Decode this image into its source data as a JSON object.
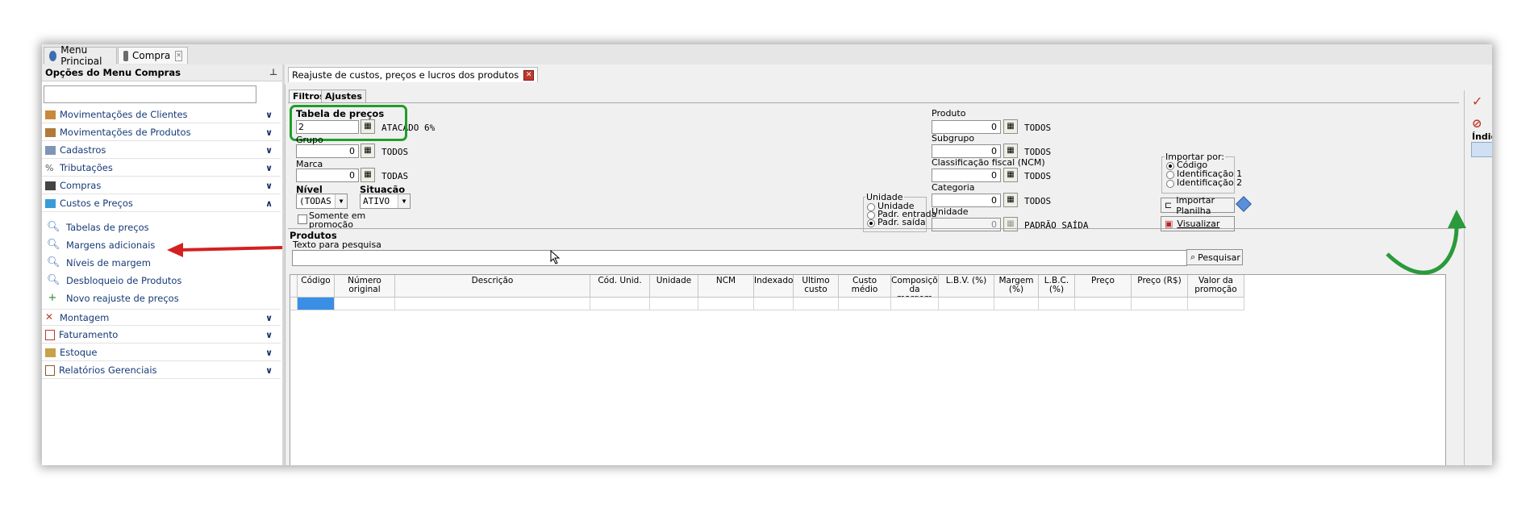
{
  "top_tabs": [
    {
      "label": "Menu Principal"
    },
    {
      "label": "Compra"
    }
  ],
  "sidebar": {
    "title": "Opções do Menu Compras",
    "categories": [
      {
        "label": "Movimentações de Clientes"
      },
      {
        "label": "Movimentações de Produtos"
      },
      {
        "label": "Cadastros"
      },
      {
        "label": "Tributações"
      },
      {
        "label": "Compras"
      },
      {
        "label": "Custos e Preços"
      },
      {
        "label": "Montagem"
      },
      {
        "label": "Faturamento"
      },
      {
        "label": "Estoque"
      },
      {
        "label": "Relatórios Gerenciais"
      }
    ],
    "sub_items": [
      {
        "label": "Tabelas de preços"
      },
      {
        "label": "Margens adicionais"
      },
      {
        "label": "Níveis de margem"
      },
      {
        "label": "Desbloqueio de Produtos"
      },
      {
        "label": "Novo reajuste de preços"
      }
    ]
  },
  "document_tab": {
    "label": "Reajuste de custos, preços e lucros dos produtos"
  },
  "subtabs": [
    {
      "label": "Filtros"
    },
    {
      "label": "Ajustes"
    }
  ],
  "filters": {
    "tabela_label": "Tabela de preços",
    "tabela_value": "2",
    "tabela_desc": "ATACADO 6%",
    "grupo_label": "Grupo",
    "grupo_value": "0",
    "grupo_desc": "TODOS",
    "marca_label": "Marca",
    "marca_value": "0",
    "marca_desc": "TODAS",
    "nivel_label": "Nível",
    "nivel_value": "(TODAS",
    "situacao_label": "Situação",
    "situacao_value": "ATIVO",
    "promo_label_1": "Somente em",
    "promo_label_2": "promoção",
    "unidade_group": "Unidade",
    "unidade_opts": [
      "Unidade",
      "Padr. entrada",
      "Padr. saída"
    ],
    "produto_label": "Produto",
    "produto_value": "0",
    "produto_desc": "TODOS",
    "subgrupo_label": "Subgrupo",
    "subgrupo_value": "0",
    "subgrupo_desc": "TODOS",
    "ncm_label": "Classificação fiscal (NCM)",
    "ncm_value": "0",
    "ncm_desc": "TODOS",
    "categoria_label": "Categoria",
    "categoria_value": "0",
    "categoria_desc": "TODOS",
    "unidade2_label": "Unidade",
    "unidade2_value": "0",
    "unidade2_desc": "PADRÃO SAÍDA",
    "importar_group": "Importar por:",
    "importar_opts": [
      "Código",
      "Identificação 1",
      "Identificação 2"
    ],
    "importar_btn": "Importar Planilha",
    "visualizar_btn": "Visualizar"
  },
  "produtos": {
    "title": "Produtos",
    "search_label": "Texto para pesquisa",
    "search_btn": "Pesquisar",
    "columns": [
      "Código",
      "Número original",
      "Descrição",
      "Cód. Unid.",
      "Unidade",
      "NCM",
      "Indexado",
      "Ultimo custo",
      "Custo médio",
      "Composições da margem",
      "L.B.V. (%)",
      "Margem (%)",
      "L.B.C. (%)",
      "Preço",
      "Preço (R$)",
      "Valor da promoção"
    ]
  },
  "right_panel": {
    "label": "Índic"
  },
  "colors": {
    "highlight_green": "#1e9e2a",
    "arrow_red": "#d42020",
    "arrow_green": "#2a9a3a",
    "selected_cell": "#3a8ee6"
  }
}
